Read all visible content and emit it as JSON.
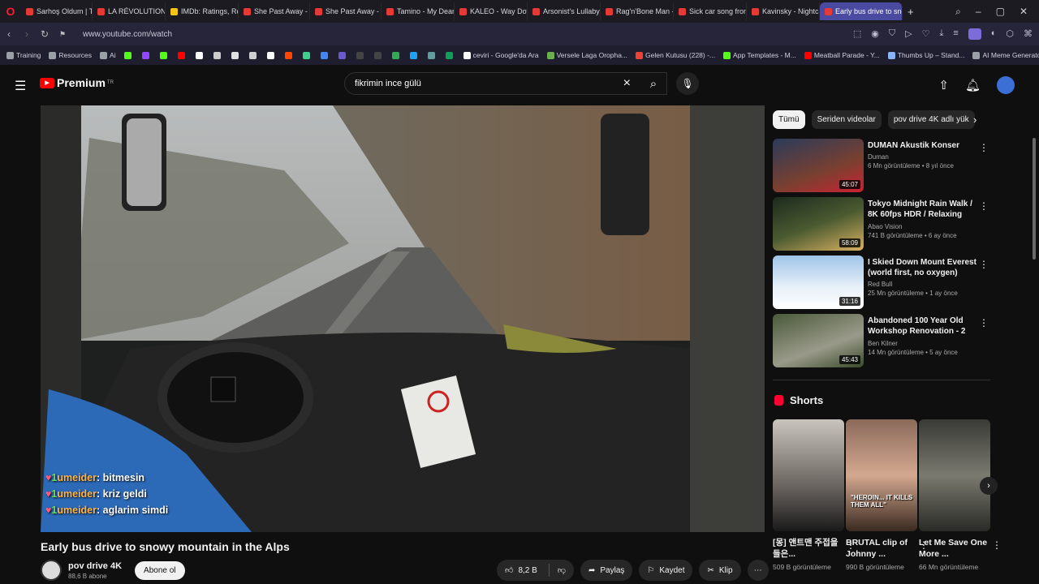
{
  "browser": {
    "tabs": [
      {
        "label": "Sarhoş Oldum | Tol",
        "color": "#e53935"
      },
      {
        "label": "LA RÉVOLUTION FI",
        "color": "#e53935"
      },
      {
        "label": "IMDb: Ratings, Revi",
        "color": "#f5c518"
      },
      {
        "label": "She Past Away - Ka",
        "color": "#e53935"
      },
      {
        "label": "She Past Away - Du",
        "color": "#e53935"
      },
      {
        "label": "Tamino - My Deare",
        "color": "#e53935"
      },
      {
        "label": "KALEO - Way Down",
        "color": "#e53935"
      },
      {
        "label": "Arsonist's Lullaby (",
        "color": "#e53935"
      },
      {
        "label": "Rag'n'Bone Man - I",
        "color": "#e53935"
      },
      {
        "label": "Sick car song from",
        "color": "#e53935"
      },
      {
        "label": "Kavinsky - Nightca",
        "color": "#e53935"
      },
      {
        "label": "Early bus drive to sno",
        "color": "#e53935"
      }
    ],
    "url": "www.youtube.com/watch",
    "bookmarks": [
      {
        "label": "Training",
        "color": "#9aa0a6"
      },
      {
        "label": "Resources",
        "color": "#9aa0a6"
      },
      {
        "label": "Ai",
        "color": "#9aa0a6"
      },
      {
        "label": "",
        "color": "#53fc18"
      },
      {
        "label": "",
        "color": "#9146ff"
      },
      {
        "label": "",
        "color": "#53fc18"
      },
      {
        "label": "",
        "color": "#ff0000"
      },
      {
        "label": "",
        "color": "#ffffff"
      },
      {
        "label": "",
        "color": "#cccccc"
      },
      {
        "label": "",
        "color": "#e0e0e0"
      },
      {
        "label": "",
        "color": "#d0d0d0"
      },
      {
        "label": "",
        "color": "#ffffff"
      },
      {
        "label": "",
        "color": "#ff4500"
      },
      {
        "label": "",
        "color": "#3ecf8e"
      },
      {
        "label": "",
        "color": "#4285f4"
      },
      {
        "label": "",
        "color": "#6a5acd"
      },
      {
        "label": "",
        "color": "#444444"
      },
      {
        "label": "",
        "color": "#444444"
      },
      {
        "label": "",
        "color": "#34a853"
      },
      {
        "label": "",
        "color": "#1da1f2"
      },
      {
        "label": "",
        "color": "#5f9ea0"
      },
      {
        "label": "",
        "color": "#0f9d58"
      },
      {
        "label": "ceviri - Google'da Ara",
        "color": "#ffffff"
      },
      {
        "label": "Versele Laga Oropha...",
        "color": "#6ab04c"
      },
      {
        "label": "Gelen Kutusu (228) -...",
        "color": "#ea4335"
      },
      {
        "label": "App Templates - M...",
        "color": "#53fc18"
      },
      {
        "label": "Meatball Parade - Y...",
        "color": "#ff0000"
      },
      {
        "label": "Thumbs Up – Stand...",
        "color": "#8ab4f8"
      },
      {
        "label": "AI Meme Generator...",
        "color": "#9aa0a6"
      }
    ]
  },
  "yt": {
    "logo_text": "Premium",
    "logo_sup": "TR",
    "search_value": "fikrimin ince gülü",
    "chat": [
      {
        "user": "umeider",
        "msg": "bitmesin"
      },
      {
        "user": "umeider",
        "msg": "kriz geldi"
      },
      {
        "user": "umeider",
        "msg": "aglarim simdi"
      }
    ],
    "video_title": "Early bus drive to snowy mountain in the Alps",
    "channel_name": "pov drive 4K",
    "channel_subs": "88,6 B abone",
    "subscribe": "Abone ol",
    "likes": "8,2 B",
    "share": "Paylaş",
    "save": "Kaydet",
    "clip": "Klip",
    "chips": [
      "Tümü",
      "Seriden videolar",
      "pov drive 4K adlı yük"
    ],
    "recs": [
      {
        "title": "DUMAN Akustik Konser",
        "channel": "Duman",
        "meta": "6 Mn görüntüleme • 8 yıl önce",
        "duration": "45:07"
      },
      {
        "title": "Tokyo Midnight Rain Walk / 8K 60fps HDR / Relaxing Piano + ...",
        "channel": "Abao Vision",
        "meta": "741 B görüntüleme • 6 ay önce",
        "duration": "58:09"
      },
      {
        "title": "I Skied Down Mount Everest (world first, no oxygen)",
        "channel": "Red Bull",
        "meta": "25 Mn görüntüleme • 1 ay önce",
        "duration": "31:16"
      },
      {
        "title": "Abandoned 100 Year Old Workshop Renovation - 2 Year...",
        "channel": "Ben Kilner",
        "meta": "14 Mn görüntüleme • 5 ay önce",
        "duration": "45:43"
      }
    ],
    "shorts_title": "Shorts",
    "shorts": [
      {
        "title": "[몽] 앤트맨 주접을 들은...",
        "views": "509 B görüntüleme"
      },
      {
        "title": "BRUTAL clip of Johnny ...",
        "views": "990 B görüntüleme"
      },
      {
        "title": "Let Me Save One More ...",
        "views": "66 Mn görüntüleme"
      }
    ],
    "short_caption": "\"HEROIN... IT KILLS THEM ALL\""
  }
}
